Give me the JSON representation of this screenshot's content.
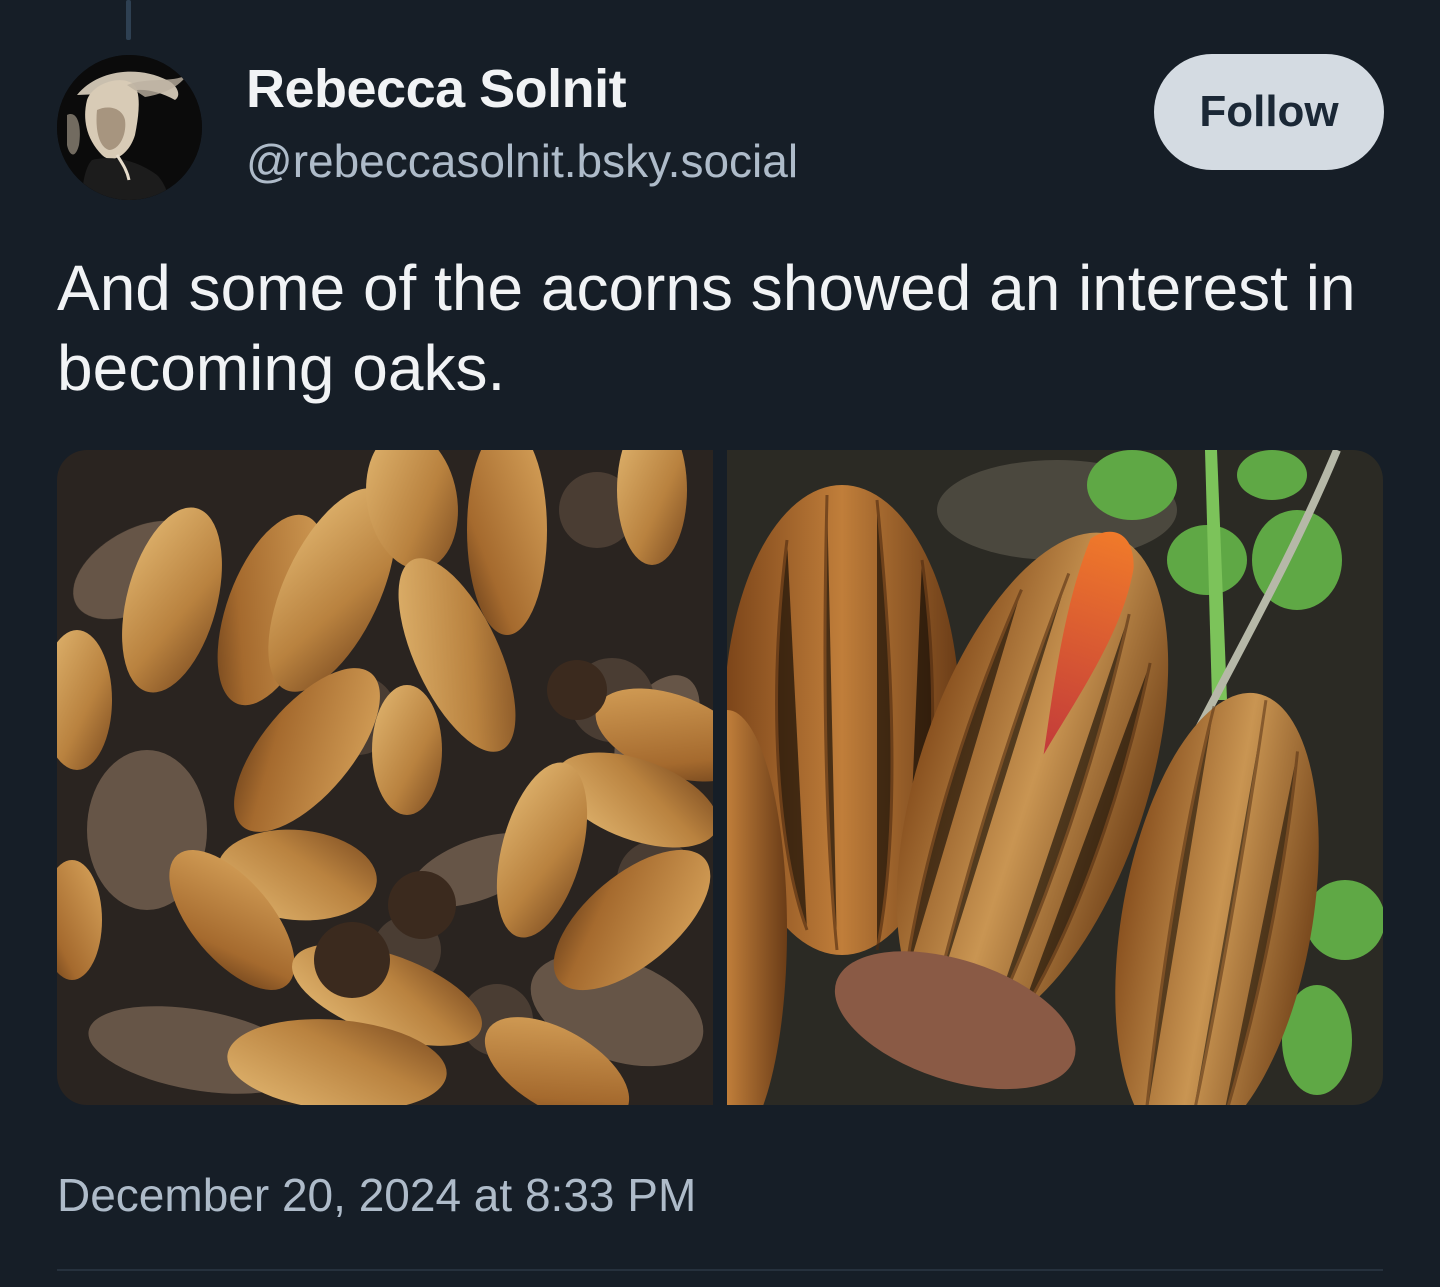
{
  "post": {
    "author": {
      "display_name": "Rebecca Solnit",
      "handle": "@rebeccasolnit.bsky.social"
    },
    "follow_label": "Follow",
    "text": "And some of the acorns showed an interest in becoming oaks.",
    "timestamp": "December 20, 2024 at 8:33 PM",
    "image_count": 2
  },
  "colors": {
    "background": "#161e27",
    "follow_button_bg": "#d4dbe2",
    "secondary_text": "#aebbc9"
  }
}
